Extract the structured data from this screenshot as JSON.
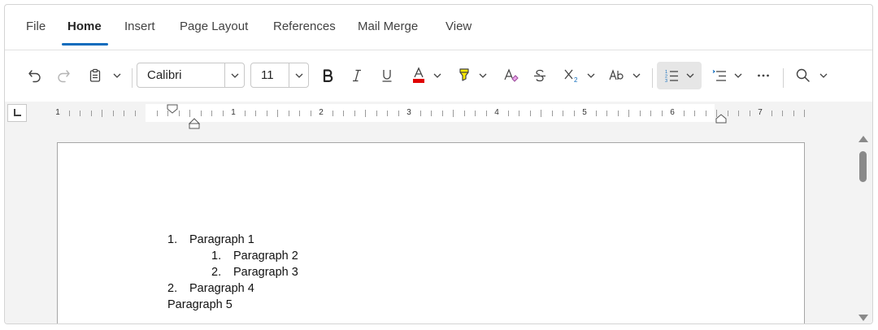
{
  "tabs": [
    {
      "label": "File"
    },
    {
      "label": "Home"
    },
    {
      "label": "Insert"
    },
    {
      "label": "Page Layout"
    },
    {
      "label": "References"
    },
    {
      "label": "Mail Merge"
    },
    {
      "label": "View"
    }
  ],
  "active_tab": "Home",
  "toolbar": {
    "font_family": "Calibri",
    "font_size": "11",
    "font_color": "#e00000",
    "highlight_color": "#ffea00",
    "accent": "#0f6cbd",
    "icons": [
      "undo-icon",
      "redo-icon",
      "clipboard-icon",
      "bold-icon",
      "italic-icon",
      "underline-icon",
      "font-color-icon",
      "highlight-icon",
      "clear-format-icon",
      "strikethrough-icon",
      "subscript-icon",
      "change-case-icon",
      "numbering-icon",
      "bullets-icon",
      "more-icon",
      "find-icon"
    ]
  },
  "ruler": {
    "numbers": [
      "1",
      "1",
      "2",
      "3",
      "4",
      "5",
      "6",
      "7"
    ]
  },
  "document": {
    "items": [
      {
        "marker": "1.",
        "text": "Paragraph 1"
      },
      {
        "marker": "1.",
        "text": "Paragraph 2"
      },
      {
        "marker": "2.",
        "text": "Paragraph 3"
      },
      {
        "marker": "2.",
        "text": "Paragraph 4"
      },
      {
        "marker": "",
        "text": "Paragraph 5"
      }
    ]
  }
}
